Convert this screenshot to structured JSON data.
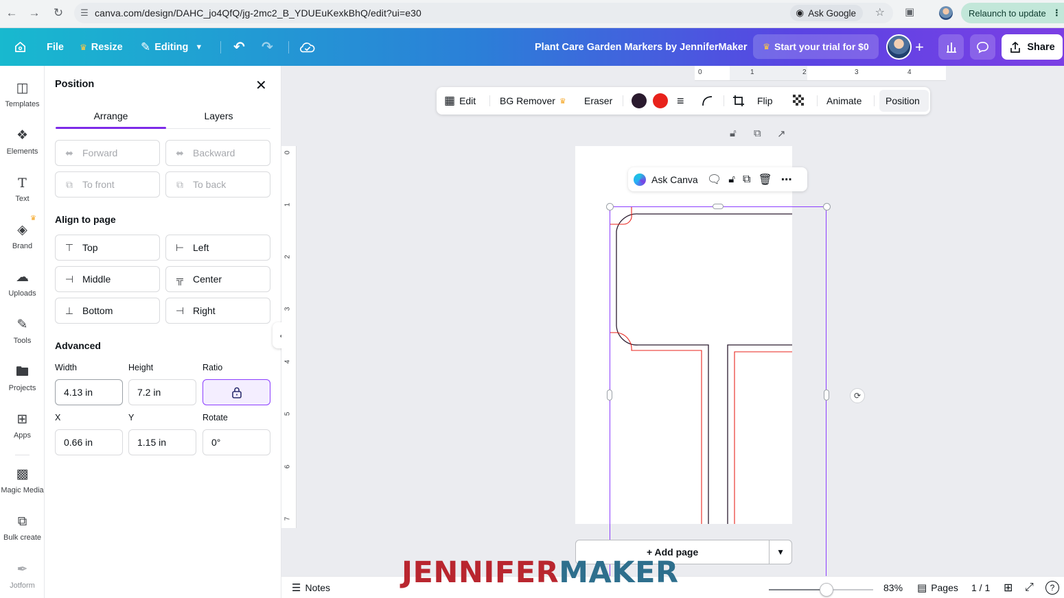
{
  "browser": {
    "url": "canva.com/design/DAHC_jo4QfQ/jg-2mc2_B_YDUEuKexkBhQ/edit?ui=e30",
    "ask_google": "Ask Google",
    "relaunch": "Relaunch to update"
  },
  "topbar": {
    "file": "File",
    "resize": "Resize",
    "editing": "Editing",
    "doc_title": "Plant Care Garden Markers by JenniferMaker",
    "trial": "Start your trial for $0",
    "share": "Share",
    "gradient": [
      "#18b9cf",
      "#2b7fd8",
      "#5a44e3",
      "#7b3fe4"
    ]
  },
  "rail": {
    "items": [
      {
        "label": "Templates",
        "icon": "templates-icon"
      },
      {
        "label": "Elements",
        "icon": "elements-icon"
      },
      {
        "label": "Text",
        "icon": "text-icon"
      },
      {
        "label": "Brand",
        "icon": "brand-icon"
      },
      {
        "label": "Uploads",
        "icon": "uploads-icon"
      },
      {
        "label": "Tools",
        "icon": "tools-icon"
      },
      {
        "label": "Projects",
        "icon": "projects-icon"
      },
      {
        "label": "Apps",
        "icon": "apps-icon"
      },
      {
        "label": "Magic Media",
        "icon": "magic-media-icon"
      },
      {
        "label": "Bulk create",
        "icon": "bulk-create-icon"
      },
      {
        "label": "Jotform",
        "icon": "jotform-icon"
      }
    ]
  },
  "panel": {
    "title": "Position",
    "tabs": [
      "Arrange",
      "Layers"
    ],
    "arrange_buttons": [
      "Forward",
      "Backward",
      "To front",
      "To back"
    ],
    "align_title": "Align to page",
    "align_buttons": [
      "Top",
      "Left",
      "Middle",
      "Center",
      "Bottom",
      "Right"
    ],
    "advanced_title": "Advanced",
    "labels": {
      "width": "Width",
      "height": "Height",
      "ratio": "Ratio",
      "x": "X",
      "y": "Y",
      "rotate": "Rotate"
    },
    "values": {
      "width": "4.13 in",
      "height": "7.2 in",
      "x": "0.66 in",
      "y": "1.15 in",
      "rotate": "0°"
    },
    "accent": "#7d2ae8"
  },
  "ruler": {
    "top": [
      "0",
      "1",
      "2",
      "3",
      "4"
    ],
    "left": [
      "0",
      "1",
      "2",
      "3",
      "4",
      "5",
      "6",
      "7"
    ]
  },
  "toolbar": {
    "edit": "Edit",
    "bg_remover": "BG Remover",
    "eraser": "Eraser",
    "colors": [
      "#2a1a2e",
      "#e8221b"
    ],
    "flip": "Flip",
    "animate": "Animate",
    "position": "Position"
  },
  "ask_canva": "Ask Canva",
  "add_page": "+ Add page",
  "footer": {
    "notes": "Notes",
    "zoom": "83%",
    "zoom_level": 0.55,
    "pages_label": "Pages",
    "pages_count": "1 / 1"
  },
  "watermark": {
    "part1": "JENNIFER",
    "part2": "MAKER"
  }
}
